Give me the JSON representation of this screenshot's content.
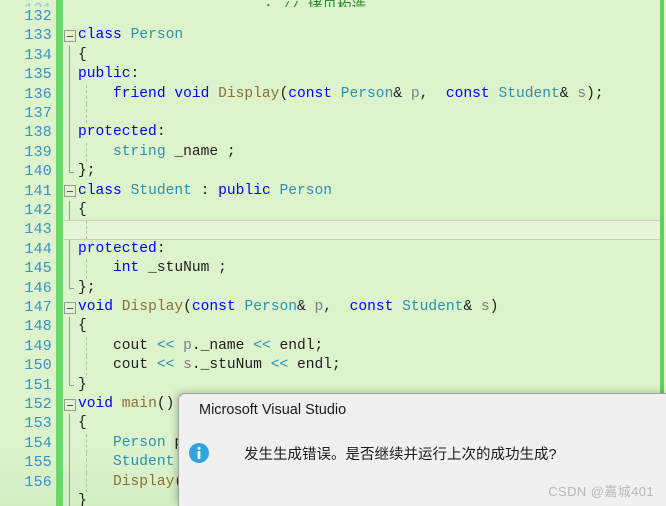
{
  "app": {
    "name": "Microsoft Visual Studio",
    "watermark": "CSDN @嘉城401"
  },
  "theme": {
    "editor_background": "#ddf3cc",
    "current_line_background": "#e4f6d6",
    "line_number_color": "#3a8fc4",
    "change_bar_color": "#69da69",
    "keyword_color": "#0000ff",
    "type_color": "#2b91af",
    "function_color": "#8b6f35",
    "variable_color": "#808080",
    "plain_text_color": "#1f1f1f",
    "dialog_background": "#f0f0f0",
    "info_icon_color": "#33a3e0"
  },
  "editor": {
    "language": "cpp",
    "current_line": 143,
    "first_visible_line": 132,
    "last_visible_line": 157,
    "lines": [
      {
        "n": "132",
        "text": "",
        "indent": 0,
        "changed": true
      },
      {
        "n": "133",
        "text": "class Person",
        "indent": 0,
        "changed": true
      },
      {
        "n": "134",
        "text": "{",
        "indent": 1,
        "changed": true
      },
      {
        "n": "135",
        "text": "public:",
        "indent": 1,
        "changed": true
      },
      {
        "n": "136",
        "text": "    friend void Display(const Person& p, const Student& s);",
        "indent": 2,
        "changed": true
      },
      {
        "n": "137",
        "text": "",
        "indent": 2,
        "changed": true
      },
      {
        "n": "138",
        "text": "protected:",
        "indent": 1,
        "changed": true
      },
      {
        "n": "139",
        "text": "    string _name ;",
        "indent": 2,
        "changed": true
      },
      {
        "n": "140",
        "text": "};",
        "indent": 1,
        "changed": true
      },
      {
        "n": "141",
        "text": "class Student : public Person",
        "indent": 0,
        "changed": true
      },
      {
        "n": "142",
        "text": "{",
        "indent": 1,
        "changed": true
      },
      {
        "n": "143",
        "text": "",
        "indent": 2,
        "changed": true
      },
      {
        "n": "144",
        "text": "protected:",
        "indent": 1,
        "changed": true
      },
      {
        "n": "145",
        "text": "    int _stuNum ;",
        "indent": 2,
        "changed": true
      },
      {
        "n": "146",
        "text": "};",
        "indent": 1,
        "changed": true
      },
      {
        "n": "147",
        "text": "void Display(const Person& p, const Student& s)",
        "indent": 0,
        "changed": true
      },
      {
        "n": "148",
        "text": "{",
        "indent": 1,
        "changed": true
      },
      {
        "n": "149",
        "text": "    cout << p._name << endl;",
        "indent": 2,
        "changed": true
      },
      {
        "n": "150",
        "text": "    cout << s._stuNum << endl;",
        "indent": 2,
        "changed": true
      },
      {
        "n": "151",
        "text": "}",
        "indent": 1,
        "changed": true
      },
      {
        "n": "152",
        "text": "void main()",
        "indent": 0,
        "changed": true
      },
      {
        "n": "153",
        "text": "{",
        "indent": 1,
        "changed": true
      },
      {
        "n": "154",
        "text": "    Person p;",
        "indent": 2,
        "changed": true
      },
      {
        "n": "155",
        "text": "    Student s;",
        "indent": 2,
        "changed": true
      },
      {
        "n": "156",
        "text": "    Display(p, s);",
        "indent": 2,
        "changed": true
      }
    ]
  },
  "dialog": {
    "title": "Microsoft Visual Studio",
    "message": "发生生成错误。是否继续并运行上次的成功生成?",
    "icon": "info-icon"
  }
}
